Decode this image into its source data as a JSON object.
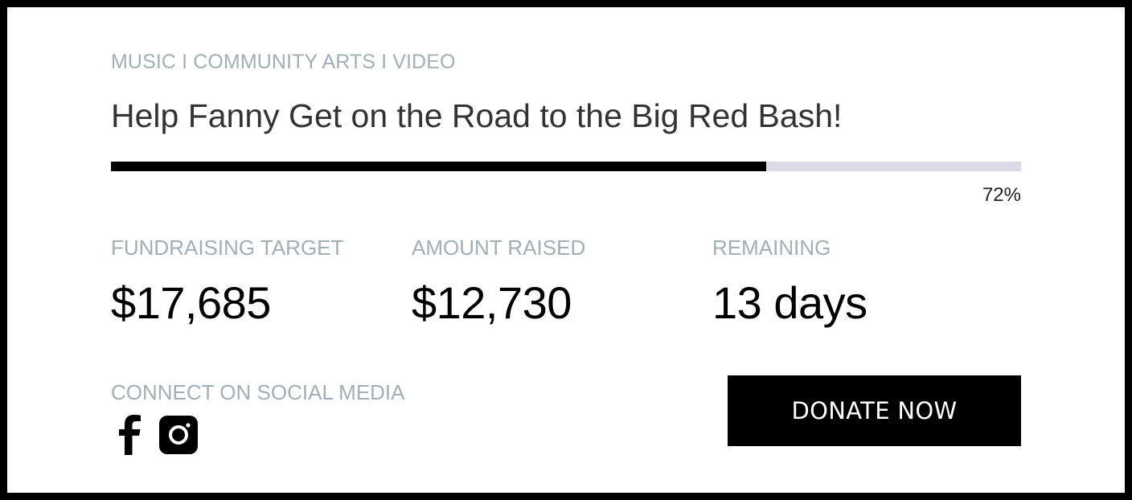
{
  "campaign": {
    "categories": "MUSIC I COMMUNITY ARTS I VIDEO",
    "title": "Help Fanny Get on the Road to the Big Red Bash!",
    "progress": {
      "percent": 72,
      "label": "72%",
      "fill_color": "#000000",
      "track_color": "#dcdae8"
    }
  },
  "stats": [
    {
      "label": "FUNDRAISING TARGET",
      "value": "$17,685"
    },
    {
      "label": "AMOUNT RAISED",
      "value": "$12,730"
    },
    {
      "label": "REMAINING",
      "value": "13 days"
    }
  ],
  "social": {
    "label": "CONNECT ON SOCIAL MEDIA",
    "icons": [
      "facebook-icon",
      "instagram-icon"
    ]
  },
  "donate": {
    "label": "DONATE NOW",
    "background": "#000000",
    "text_color": "#ffffff"
  },
  "colors": {
    "muted_text": "#a3afb8",
    "title_text": "#333333"
  }
}
